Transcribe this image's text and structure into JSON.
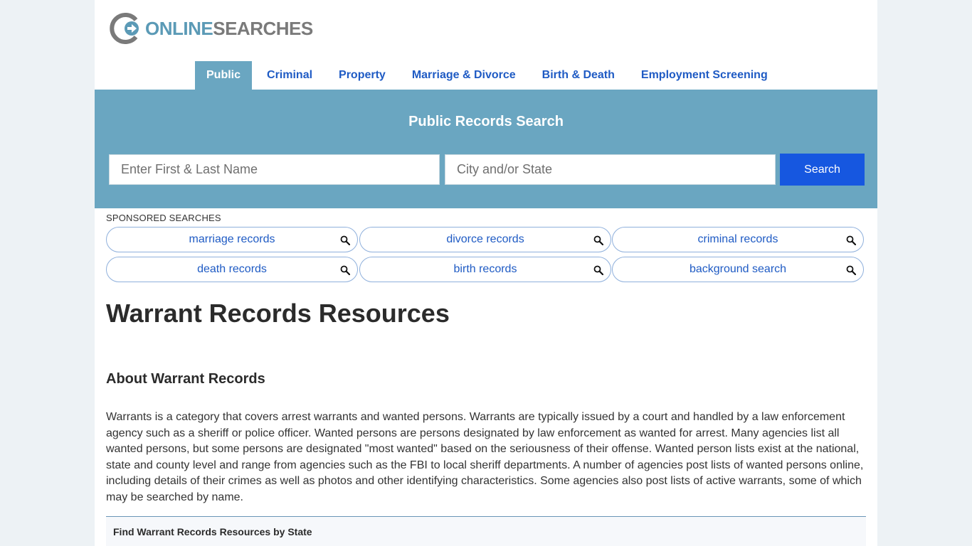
{
  "brand": {
    "logo_online": "ONLINE",
    "logo_searches": "SEARCHES",
    "colors": {
      "primary": "#6aa6c1",
      "link": "#1f5bc4",
      "button": "#1657e0"
    }
  },
  "nav": {
    "items": [
      {
        "label": "Public",
        "active": true
      },
      {
        "label": "Criminal"
      },
      {
        "label": "Property"
      },
      {
        "label": "Marriage & Divorce"
      },
      {
        "label": "Birth & Death"
      },
      {
        "label": "Employment Screening"
      }
    ]
  },
  "search": {
    "title": "Public Records Search",
    "name_placeholder": "Enter First & Last Name",
    "city_placeholder": "City and/or State",
    "button_label": "Search"
  },
  "sponsored": {
    "label": "SPONSORED SEARCHES",
    "icon": "magnifier-icon",
    "items": [
      {
        "label": "marriage records"
      },
      {
        "label": "divorce records"
      },
      {
        "label": "criminal records"
      },
      {
        "label": "death records"
      },
      {
        "label": "birth records"
      },
      {
        "label": "background search"
      }
    ]
  },
  "content": {
    "page_title": "Warrant Records Resources",
    "about_heading": "About Warrant Records",
    "about_text": "Warrants is a category that covers arrest warrants and wanted persons. Warrants are typically issued by a court and handled by a law enforcement agency such as a sheriff or police officer. Wanted persons are persons designated by law enforcement as wanted for arrest. Many agencies list all wanted persons, but some persons are designated \"most wanted\" based on the seriousness of their offense. Wanted person lists exist at the national, state and county level and range from agencies such as the FBI to local sheriff departments. A number of agencies post lists of wanted persons online, including details of their crimes as well as photos and other identifying characteristics. Some agencies also post lists of active warrants, some of which may be searched by name.",
    "state_box_title": "Find Warrant Records Resources by State"
  }
}
